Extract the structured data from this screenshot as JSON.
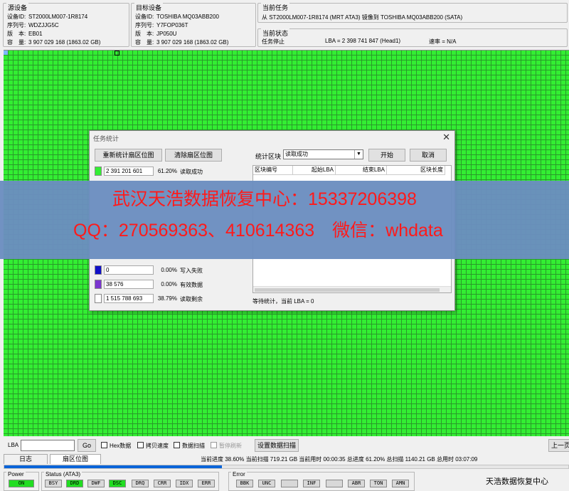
{
  "source": {
    "title": "源设备",
    "lines": [
      {
        "label": "设备ID:",
        "value": "ST2000LM007-1R8174"
      },
      {
        "label": "序列号:",
        "value": "WDZJJG5C"
      },
      {
        "label": "版　本:",
        "value": "EB01"
      },
      {
        "label": "容　量:",
        "value": "3 907 029 168 (1863.02 GB)"
      }
    ]
  },
  "target": {
    "title": "目标设备",
    "lines": [
      {
        "label": "设备ID:",
        "value": "TOSHIBA MQ03ABB200"
      },
      {
        "label": "序列号:",
        "value": "Y7FOP036T"
      },
      {
        "label": "版　本:",
        "value": "JP050U"
      },
      {
        "label": "容　量:",
        "value": "3 907 029 168 (1863.02 GB)"
      }
    ]
  },
  "task": {
    "title": "当前任务",
    "description": "从 ST2000LM007-1R8174 (MRT ATA3) 镜像到 TOSHIBA MQ03ABB200 (SATA)"
  },
  "state": {
    "title": "当前状态",
    "status": "任务停止",
    "lba": "LBA = 2 398 741 847 (Head1)",
    "rate": "速率 = N/A"
  },
  "dialog": {
    "title": "任务统计",
    "recount_btn": "重新统计扇区位图",
    "clear_btn": "清除扇区位图",
    "block_label": "统计区块",
    "block_value": "读取成功",
    "start_btn": "开始",
    "cancel_btn": "取消",
    "columns": [
      "区块编号",
      "起始LBA",
      "结束LBA",
      "区块长度"
    ],
    "rows": [
      {
        "color": "#33ee33",
        "count": "2 391 201 601",
        "pct": "61.20%",
        "name": "读取成功"
      },
      {
        "color": "#1010c8",
        "count": "0",
        "pct": "0.00%",
        "name": "写入失败"
      },
      {
        "color": "#7b36d0",
        "count": "38 576",
        "pct": "0.00%",
        "name": "有效数据"
      },
      {
        "color": "#ffffff",
        "count": "1 515 788 693",
        "pct": "38.79%",
        "name": "读取剩余"
      }
    ],
    "wait_text": "等待统计，当前 LBA = 0"
  },
  "banner": {
    "line1": "武汉天浩数据恢复中心：15337206398",
    "line2": "QQ：270569363、410614363　微信：whdata"
  },
  "controls": {
    "lba_label": "LBA",
    "go_btn": "Go",
    "hex_label": "Hex数据",
    "copy_speed_label": "拷贝速度",
    "data_scan_label": "数据扫描",
    "pause_refresh_label": "暂停刷新",
    "set_scan_btn": "设置数据扫描",
    "prev_page_btn": "上一页"
  },
  "tabs": [
    "日志",
    "扇区位图"
  ],
  "progress": {
    "text": "当前进度  38.60%  当前扫描  719.21 GB  当前用时  00:00:35      总进度  61.20%  总扫描  1140.21 GB  总用时  03:07:09",
    "fraction": 0.386
  },
  "power": {
    "title": "Power",
    "on": "ON"
  },
  "status_group": {
    "title": "Status (ATA3)",
    "leds": [
      {
        "label": "BSY",
        "on": false
      },
      {
        "label": "DRD",
        "on": true
      },
      {
        "label": "DWF",
        "on": false
      },
      {
        "label": "DSC",
        "on": true
      },
      {
        "label": "DRQ",
        "on": false
      },
      {
        "label": "CRR",
        "on": false
      },
      {
        "label": "IDX",
        "on": false
      },
      {
        "label": "ERR",
        "on": false
      }
    ]
  },
  "error_group": {
    "title": "Error",
    "leds": [
      "BBK",
      "UNC",
      "",
      "INF",
      "",
      "ABR",
      "TON",
      "AMN"
    ]
  },
  "brand": "天浩数据恢复中心"
}
